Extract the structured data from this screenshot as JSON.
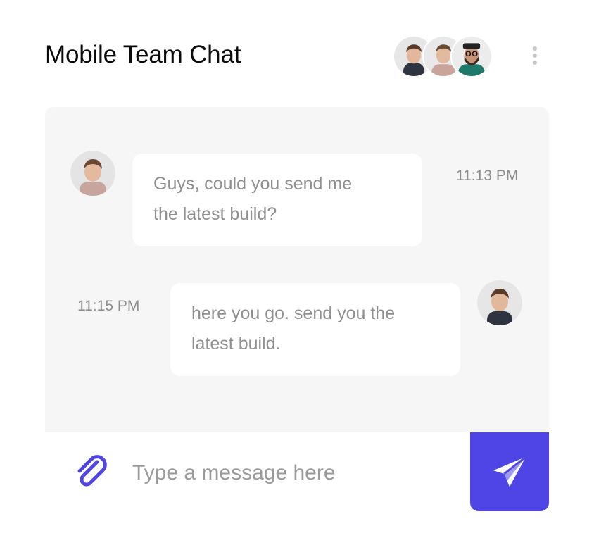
{
  "header": {
    "title": "Mobile Team Chat"
  },
  "participants": [
    "avatar-man-dark-shirt",
    "avatar-man-pink-shirt",
    "avatar-man-beard-glasses"
  ],
  "messages": [
    {
      "text_line1": "Guys, could you send me",
      "text_line2": "the latest build?",
      "time": "11:13 PM",
      "side": "left"
    },
    {
      "text_line1": "here you go. send you the",
      "text_line2": "latest build.",
      "time": "11:15 PM",
      "side": "right"
    }
  ],
  "composer": {
    "placeholder": "Type a message here",
    "attach_icon": "paperclip-icon",
    "send_icon": "paper-plane-icon"
  },
  "colors": {
    "accent": "#4f45e6",
    "panel_bg": "#f6f6f6",
    "bubble_text": "#8f8f8f"
  }
}
